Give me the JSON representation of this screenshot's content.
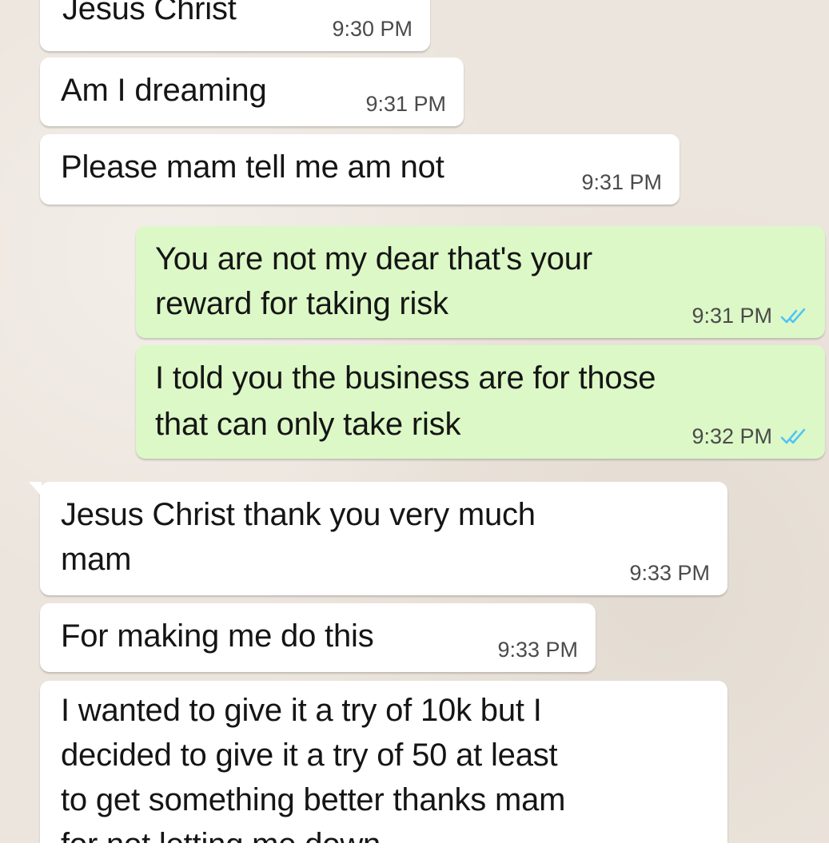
{
  "messages": [
    {
      "id": "m1",
      "dir": "in",
      "lines": [
        "Jesus Christ"
      ],
      "time": "9:30 PM"
    },
    {
      "id": "m2",
      "dir": "in",
      "lines": [
        "Am I dreaming"
      ],
      "time": "9:31 PM"
    },
    {
      "id": "m3",
      "dir": "in",
      "lines": [
        "Please mam tell me am not"
      ],
      "time": "9:31 PM"
    },
    {
      "id": "m4",
      "dir": "out",
      "lines": [
        "You are not my dear that's your",
        "reward for taking risk"
      ],
      "time": "9:31 PM",
      "status": "read-double-check"
    },
    {
      "id": "m5",
      "dir": "out",
      "lines": [
        "I told you the business are for those",
        "that can only take risk"
      ],
      "time": "9:32 PM",
      "status": "read-double-check"
    },
    {
      "id": "m6",
      "dir": "in",
      "lines": [
        "Jesus Christ thank you very much",
        "mam"
      ],
      "time": "9:33 PM"
    },
    {
      "id": "m7",
      "dir": "in",
      "lines": [
        "For making me do this"
      ],
      "time": "9:33 PM"
    },
    {
      "id": "m8",
      "dir": "in",
      "lines": [
        "I wanted to give it a try of 10k but I",
        "decided to give it a try of 50 at least",
        "to get something better thanks mam",
        "for not letting me down"
      ],
      "time": ""
    }
  ],
  "colors": {
    "chat_background": "#ece5dd",
    "incoming_bubble": "#ffffff",
    "outgoing_bubble": "#dcf8c6",
    "read_check": "#4fc3f7"
  },
  "icons": {
    "read_receipt": "double-check-icon"
  }
}
